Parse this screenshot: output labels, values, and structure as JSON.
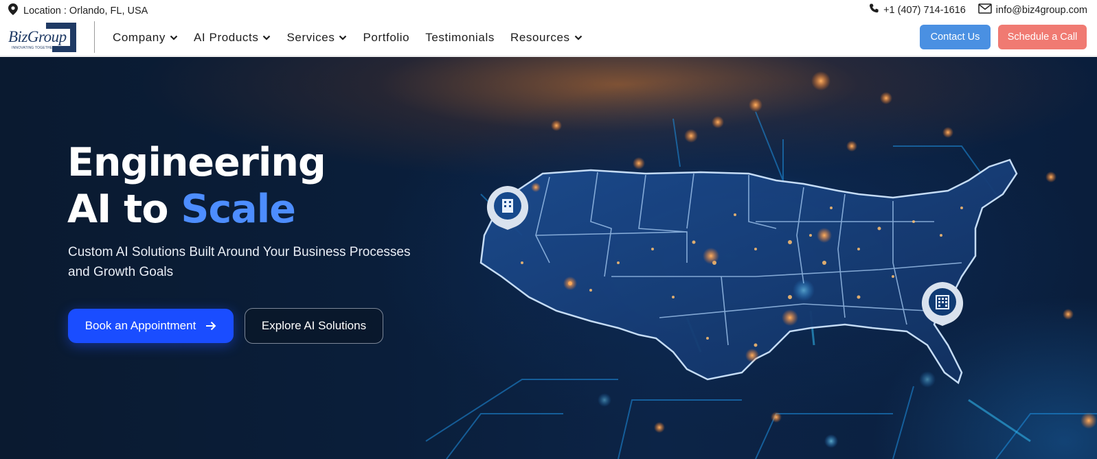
{
  "topbar": {
    "location": "Location : Orlando, FL, USA",
    "phone": "+1 (407) 714-1616",
    "email": "info@biz4group.com",
    "icons": [
      "map-pin-icon",
      "phone-icon",
      "mail-icon"
    ]
  },
  "logo": {
    "name": "BizGroup",
    "tagline": "INNOVATING TOGETHER"
  },
  "nav": {
    "items": [
      {
        "label": "Company",
        "dropdown": true
      },
      {
        "label": "AI Products",
        "dropdown": true
      },
      {
        "label": "Services",
        "dropdown": true
      },
      {
        "label": "Portfolio",
        "dropdown": false
      },
      {
        "label": "Testimonials",
        "dropdown": false
      },
      {
        "label": "Resources",
        "dropdown": true
      }
    ],
    "contact_label": "Contact Us",
    "schedule_label": "Schedule a Call"
  },
  "hero": {
    "title_line1": "Engineering",
    "title_line2_prefix": "AI to ",
    "title_line2_accent": "Scale",
    "subtitle": "Custom AI Solutions Built Around Your Business Processes and Growth Goals",
    "primary_cta": "Book an Appointment",
    "secondary_cta": "Explore AI Solutions"
  },
  "colors": {
    "accent_blue": "#4d8dff",
    "primary_button": "#1a4dff",
    "contact_button": "#4a90e2",
    "schedule_button": "#f07a72",
    "brand_navy": "#1f3a64"
  }
}
